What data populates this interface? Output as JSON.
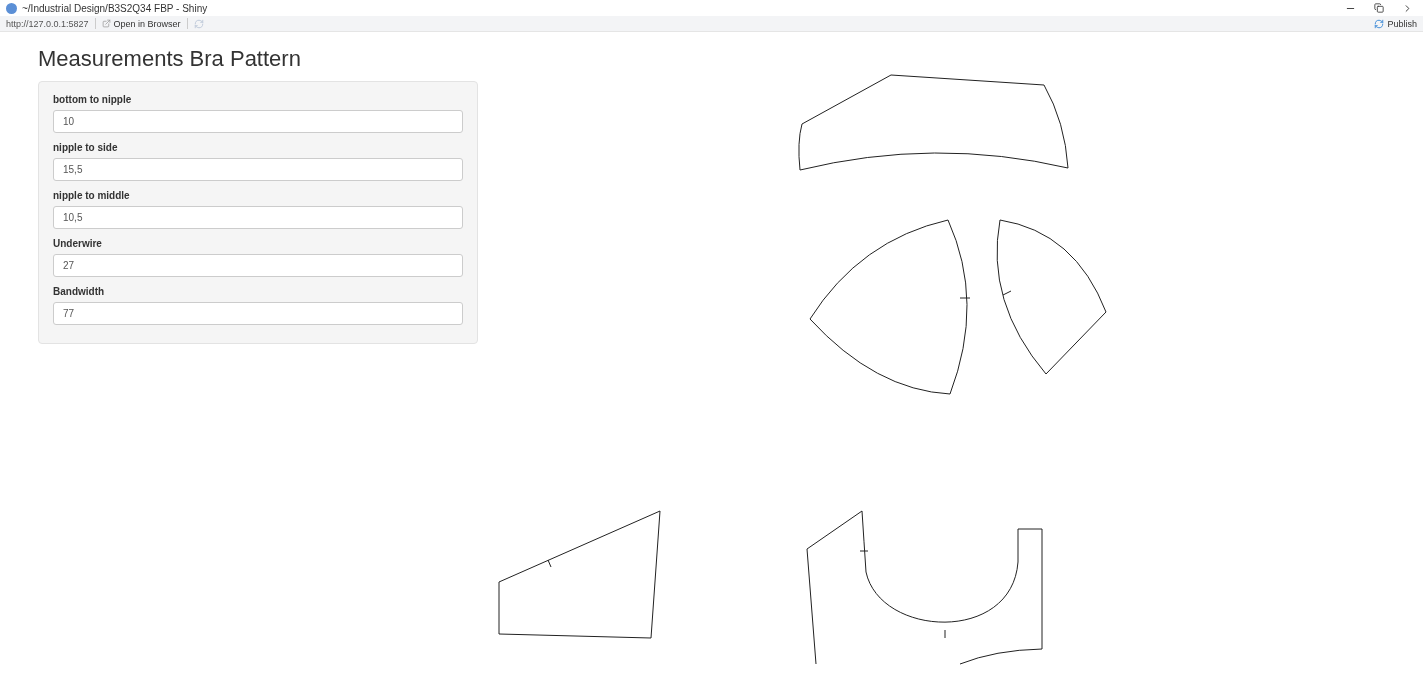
{
  "window": {
    "title": "~/Industrial Design/B3S2Q34 FBP - Shiny"
  },
  "toolbar": {
    "url": "http://127.0.0.1:5827",
    "open_in_browser": "Open in Browser",
    "publish": "Publish"
  },
  "heading": "Measurements Bra Pattern",
  "inputs": [
    {
      "label": "bottom to nipple",
      "value": "10"
    },
    {
      "label": "nipple to side",
      "value": "15,5"
    },
    {
      "label": "nipple to middle",
      "value": "10,5"
    },
    {
      "label": "Underwire",
      "value": "27"
    },
    {
      "label": "Bandwidth",
      "value": "77"
    }
  ]
}
